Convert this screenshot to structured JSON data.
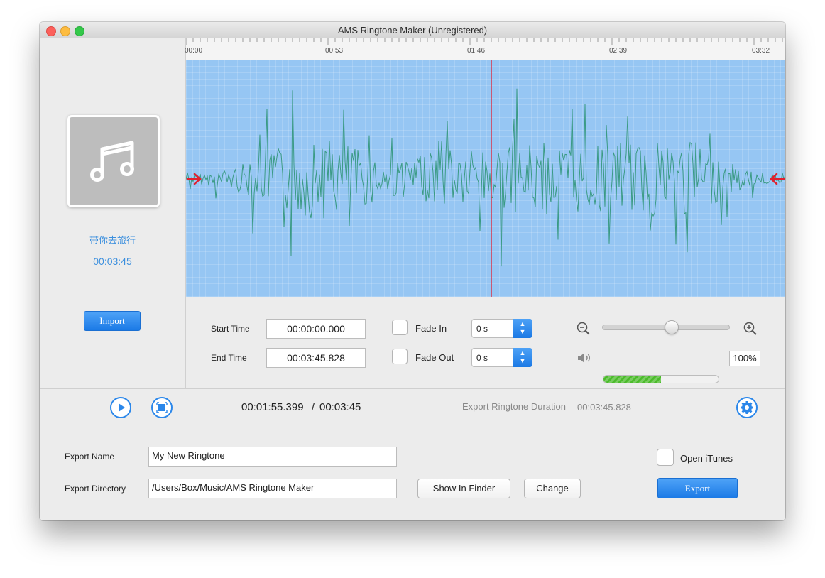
{
  "window": {
    "title": "AMS Ringtone Maker (Unregistered)"
  },
  "song": {
    "title": "带你去旅行",
    "duration": "00:03:45"
  },
  "left": {
    "import_label": "Import",
    "album_icon": "music-note-icon"
  },
  "ruler": {
    "labels": [
      "00:00",
      "00:53",
      "01:46",
      "02:39",
      "03:32"
    ]
  },
  "controls": {
    "start_label": "Start Time",
    "start_value": "00:00:00.000",
    "end_label": "End Time",
    "end_value": "00:03:45.828",
    "fade_in_label": "Fade In",
    "fade_in_value": "0 s",
    "fade_out_label": "Fade Out",
    "fade_out_value": "0 s",
    "zoom_level": 0.55,
    "volume_level": 0.5,
    "volume_value": "100%"
  },
  "transport": {
    "current_time": "00:01:55.399",
    "separator": "/",
    "total_time": "00:03:45",
    "export_duration_label": "Export Ringtone Duration",
    "export_duration_value": "00:03:45.828"
  },
  "export": {
    "name_label": "Export Name",
    "name_value": "My New Ringtone",
    "dir_label": "Export Directory",
    "dir_value": "/Users/Box/Music/AMS Ringtone Maker",
    "show_in_finder": "Show In Finder",
    "change": "Change",
    "open_itunes_label": "Open iTunes",
    "export_button": "Export"
  },
  "colors": {
    "accent": "#2b87ea",
    "wave_bg": "#96c6f3",
    "wave_line": "#3a9a84",
    "playhead": "#d9344a",
    "marker": "#e0202f",
    "volume": "#4bbb2b"
  }
}
